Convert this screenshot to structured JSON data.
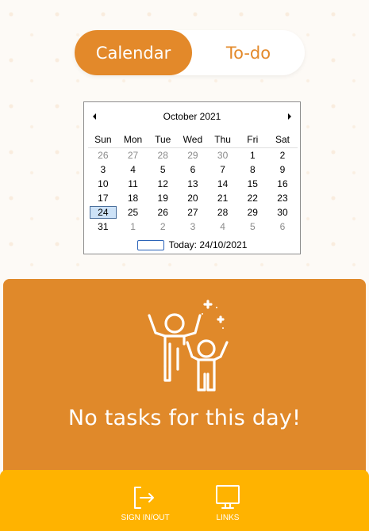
{
  "tabs": {
    "calendar_label": "Calendar",
    "todo_label": "To-do",
    "active": "Calendar"
  },
  "calendar": {
    "month_title": "October 2021",
    "weekdays": [
      "Sun",
      "Mon",
      "Tue",
      "Wed",
      "Thu",
      "Fri",
      "Sat"
    ],
    "weeks": [
      [
        "26",
        "27",
        "28",
        "29",
        "30",
        "1",
        "2"
      ],
      [
        "3",
        "4",
        "5",
        "6",
        "7",
        "8",
        "9"
      ],
      [
        "10",
        "11",
        "12",
        "13",
        "14",
        "15",
        "16"
      ],
      [
        "17",
        "18",
        "19",
        "20",
        "21",
        "22",
        "23"
      ],
      [
        "24",
        "25",
        "26",
        "27",
        "28",
        "29",
        "30"
      ],
      [
        "31",
        "1",
        "2",
        "3",
        "4",
        "5",
        "6"
      ]
    ],
    "selected_day": "24",
    "today_label": "Today: 24/10/2021"
  },
  "empty_state": {
    "message": "No tasks for this day!",
    "icon": "celebrating-people-icon"
  },
  "bottom_nav": {
    "sign_label": "SIGN IN/OUT",
    "sign_icon": "sign-in-out-icon",
    "links_label": "LINKS",
    "links_icon": "monitor-icon"
  },
  "colors": {
    "accent": "#e3892a",
    "panel": "#e0892a",
    "bottom_bar": "#ffb300",
    "selected_day_bg": "#cde2f7"
  }
}
